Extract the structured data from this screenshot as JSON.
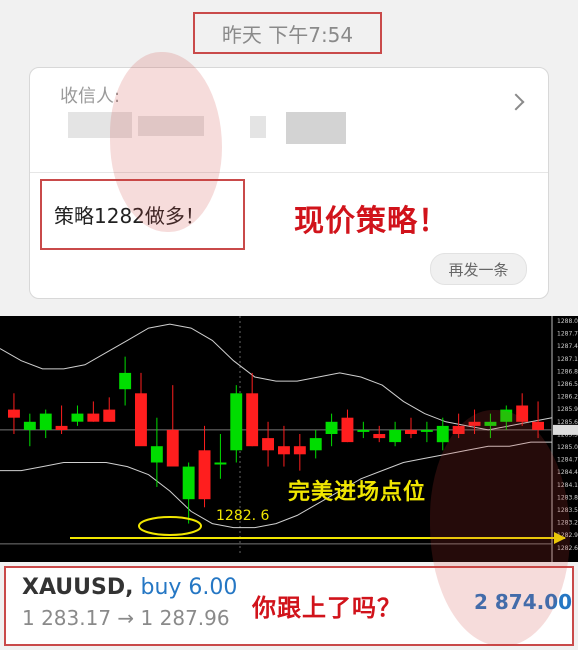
{
  "header": {
    "timestamp": "昨天 下午7:54"
  },
  "message_card": {
    "recipient_label": "收信人:",
    "message_text": "策略1282做多！",
    "resend_label": "再发一条"
  },
  "annotations": {
    "strategy_note": "现价策略！",
    "entry_note": "完美进场点位",
    "follow_note": "你跟上了吗？"
  },
  "chart": {
    "entry_level": "1282. 6",
    "price_ticks": [
      "1288.00",
      "1287.75",
      "1287.45",
      "1287.15",
      "1286.85",
      "1286.55",
      "1286.25",
      "1285.95",
      "1285.65",
      "1285.35",
      "1285.05",
      "1284.75",
      "1284.45",
      "1284.15",
      "1283.85",
      "1283.55",
      "1283.25",
      "1282.95",
      "1282.65"
    ],
    "colors": {
      "up": "#00dd00",
      "down": "#ff1e1e",
      "annotation": "#f0e600"
    }
  },
  "chart_data": {
    "type": "candlestick",
    "ylim": [
      1282.5,
      1288.1
    ],
    "candles": [
      {
        "o": 1285.9,
        "h": 1286.3,
        "l": 1285.3,
        "c": 1285.7
      },
      {
        "o": 1285.4,
        "h": 1285.8,
        "l": 1285.0,
        "c": 1285.6
      },
      {
        "o": 1285.4,
        "h": 1285.9,
        "l": 1285.2,
        "c": 1285.8
      },
      {
        "o": 1285.5,
        "h": 1286.0,
        "l": 1285.3,
        "c": 1285.4
      },
      {
        "o": 1285.6,
        "h": 1286.0,
        "l": 1285.5,
        "c": 1285.8
      },
      {
        "o": 1285.8,
        "h": 1286.1,
        "l": 1285.6,
        "c": 1285.6
      },
      {
        "o": 1285.9,
        "h": 1286.2,
        "l": 1285.6,
        "c": 1285.6
      },
      {
        "o": 1286.4,
        "h": 1287.2,
        "l": 1286.0,
        "c": 1286.8
      },
      {
        "o": 1286.3,
        "h": 1286.8,
        "l": 1285.8,
        "c": 1285.0
      },
      {
        "o": 1284.6,
        "h": 1285.7,
        "l": 1284.0,
        "c": 1285.0
      },
      {
        "o": 1285.4,
        "h": 1286.5,
        "l": 1284.6,
        "c": 1284.5
      },
      {
        "o": 1283.7,
        "h": 1284.6,
        "l": 1283.1,
        "c": 1284.5
      },
      {
        "o": 1284.9,
        "h": 1285.5,
        "l": 1283.5,
        "c": 1283.7
      },
      {
        "o": 1284.6,
        "h": 1285.3,
        "l": 1284.2,
        "c": 1284.6
      },
      {
        "o": 1284.9,
        "h": 1286.5,
        "l": 1284.6,
        "c": 1286.3
      },
      {
        "o": 1286.3,
        "h": 1286.8,
        "l": 1285.0,
        "c": 1285.0
      },
      {
        "o": 1285.2,
        "h": 1285.6,
        "l": 1284.5,
        "c": 1284.9
      },
      {
        "o": 1285.0,
        "h": 1285.5,
        "l": 1284.5,
        "c": 1284.8
      },
      {
        "o": 1285.0,
        "h": 1285.3,
        "l": 1284.4,
        "c": 1284.8
      },
      {
        "o": 1284.9,
        "h": 1285.4,
        "l": 1284.7,
        "c": 1285.2
      },
      {
        "o": 1285.3,
        "h": 1285.8,
        "l": 1285.0,
        "c": 1285.6
      },
      {
        "o": 1285.7,
        "h": 1285.9,
        "l": 1285.1,
        "c": 1285.1
      },
      {
        "o": 1285.4,
        "h": 1285.6,
        "l": 1285.2,
        "c": 1285.4
      },
      {
        "o": 1285.3,
        "h": 1285.5,
        "l": 1285.1,
        "c": 1285.2
      },
      {
        "o": 1285.1,
        "h": 1285.6,
        "l": 1285.0,
        "c": 1285.4
      },
      {
        "o": 1285.4,
        "h": 1285.7,
        "l": 1285.2,
        "c": 1285.3
      },
      {
        "o": 1285.4,
        "h": 1285.6,
        "l": 1285.1,
        "c": 1285.4
      },
      {
        "o": 1285.1,
        "h": 1285.7,
        "l": 1284.9,
        "c": 1285.5
      },
      {
        "o": 1285.5,
        "h": 1285.8,
        "l": 1285.2,
        "c": 1285.3
      },
      {
        "o": 1285.6,
        "h": 1285.9,
        "l": 1285.3,
        "c": 1285.5
      },
      {
        "o": 1285.5,
        "h": 1285.8,
        "l": 1285.2,
        "c": 1285.6
      },
      {
        "o": 1285.6,
        "h": 1286.0,
        "l": 1285.4,
        "c": 1285.9
      },
      {
        "o": 1286.0,
        "h": 1286.3,
        "l": 1285.5,
        "c": 1285.6
      },
      {
        "o": 1285.6,
        "h": 1286.1,
        "l": 1285.2,
        "c": 1285.4
      }
    ]
  },
  "trade": {
    "symbol": "XAUUSD,",
    "side": "buy 6.00",
    "prices": "1 283.17 → 1 287.96",
    "profit": "2 874.00"
  }
}
